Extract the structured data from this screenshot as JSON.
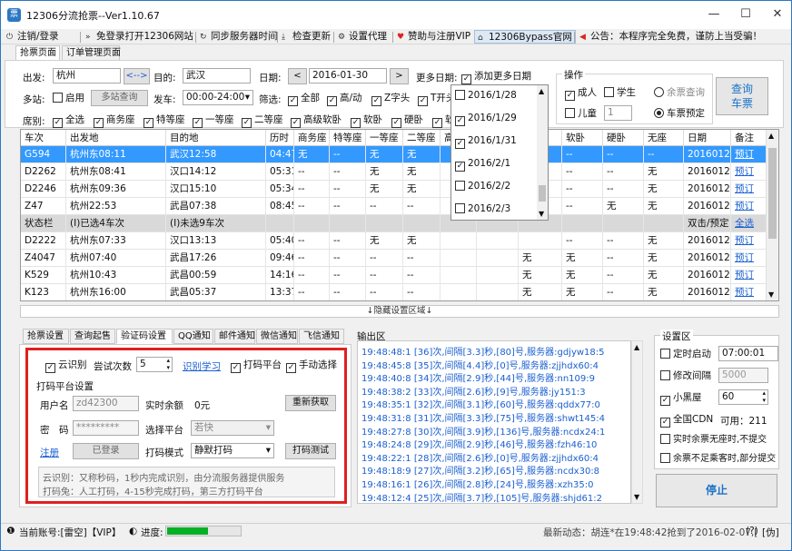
{
  "window": {
    "title": "12306分流抢票--Ver1.10.67",
    "minimize": "—",
    "maximize": "☐",
    "close": "✕"
  },
  "menu": [
    {
      "icon": "logout-icon",
      "glyph": "⏻",
      "label": "注销/登录"
    },
    {
      "icon": "forward-icon",
      "glyph": "»",
      "label": "免登录打开12306网站"
    },
    {
      "icon": "sync-icon",
      "glyph": "↻",
      "label": "同步服务器时间"
    },
    {
      "icon": "download-icon",
      "glyph": "⤓",
      "label": "检查更新"
    },
    {
      "icon": "gear-icon",
      "glyph": "⚙",
      "label": "设置代理"
    },
    {
      "icon": "heart-icon",
      "glyph": "♥",
      "label": "赞助与注册VIP"
    },
    {
      "icon": "home-icon",
      "glyph": "⌂",
      "label": "12306Bypass官网"
    },
    {
      "icon": "speaker-icon",
      "glyph": "◀",
      "label": "公告：本程序完全免费，谨防上当受骗！"
    }
  ],
  "main_tabs": [
    "抢票页面",
    "订单管理页面"
  ],
  "form": {
    "from_label": "出发:",
    "from_value": "杭州",
    "swap_label": "<-->",
    "to_label": "目的:",
    "to_value": "武汉",
    "date_label": "日期:",
    "date_value": "2016-01-30",
    "prev": "<",
    "next": ">",
    "more_dates_label": "更多日期:",
    "add_more_dates": "添加更多日期",
    "multi_label": "多站:",
    "enable_label": "启用",
    "multi_query": "多站查询",
    "depart_label": "发车:",
    "depart_value": "00:00-24:00",
    "filter_label": "筛选:",
    "filters": [
      "全部",
      "高/动",
      "Z字头",
      "T开头"
    ],
    "seat_label": "席别:",
    "seats": [
      "全选",
      "商务座",
      "特等座",
      "一等座",
      "二等座",
      "高级软卧",
      "软卧",
      "硬卧",
      "软"
    ]
  },
  "ops": {
    "title": "操作",
    "adult": "成人",
    "student": "学生",
    "child": "儿童",
    "child_count": "1",
    "query_remaining": "余票查询",
    "predict": "车票预定",
    "query_button": "查询车票"
  },
  "date_dropdown": [
    {
      "date": "2016/1/28",
      "checked": false
    },
    {
      "date": "2016/1/29",
      "checked": true
    },
    {
      "date": "2016/1/31",
      "checked": true
    },
    {
      "date": "2016/2/1",
      "checked": true
    },
    {
      "date": "2016/2/2",
      "checked": false
    },
    {
      "date": "2016/2/3",
      "checked": false
    }
  ],
  "table": {
    "headers": [
      "车次",
      "出发地",
      "目的地",
      "历时",
      "商务座",
      "特等座",
      "一等座",
      "二等座",
      "高",
      "",
      "",
      "软卧",
      "硬卧",
      "无座",
      "日期",
      "备注"
    ],
    "rows": [
      [
        "G594",
        "杭州东08:11",
        "武汉12:58",
        "04:47",
        "无",
        "--",
        "无",
        "无",
        "",
        "",
        "",
        "--",
        "--",
        "--",
        "20160129",
        "预订"
      ],
      [
        "D2262",
        "杭州东08:41",
        "汉口14:12",
        "05:31",
        "--",
        "--",
        "无",
        "无",
        "",
        "",
        "",
        "--",
        "--",
        "无",
        "20160129",
        "预订"
      ],
      [
        "D2246",
        "杭州东09:36",
        "汉口15:10",
        "05:34",
        "--",
        "--",
        "无",
        "无",
        "",
        "",
        "",
        "--",
        "--",
        "无",
        "20160129",
        "预订"
      ],
      [
        "Z47",
        "杭州22:53",
        "武昌07:38",
        "08:45",
        "--",
        "--",
        "--",
        "--",
        "",
        "",
        "",
        "--",
        "无",
        "无",
        "20160129",
        "预订"
      ],
      [
        "状态栏",
        "(I)已选4车次",
        "(I)未选9车次",
        "",
        "",
        "",
        "",
        "",
        "",
        "",
        "",
        "",
        "",
        "",
        "双击/预定",
        "全选"
      ],
      [
        "D2222",
        "杭州东07:33",
        "汉口13:13",
        "05:40",
        "--",
        "--",
        "无",
        "无",
        "",
        "",
        "",
        "--",
        "--",
        "无",
        "20160129",
        "预订"
      ],
      [
        "Z4047",
        "杭州07:40",
        "武昌17:26",
        "09:46",
        "--",
        "--",
        "--",
        "--",
        "",
        "",
        "无",
        "无",
        "--",
        "无",
        "20160129",
        "预订"
      ],
      [
        "K529",
        "杭州10:43",
        "武昌00:59",
        "14:16",
        "--",
        "--",
        "--",
        "--",
        "",
        "",
        "无",
        "无",
        "--",
        "无",
        "20160129",
        "预订"
      ],
      [
        "K123",
        "杭州东16:00",
        "武昌05:37",
        "13:37",
        "--",
        "--",
        "--",
        "--",
        "",
        "",
        "无",
        "无",
        "--",
        "无",
        "20160129",
        "预订"
      ]
    ]
  },
  "hide_settings": "↓隐藏设置区域↓",
  "sub_tabs": [
    "抢票设置",
    "查询起售",
    "验证码设置",
    "QQ通知",
    "邮件通知",
    "微信通知",
    "飞信通知"
  ],
  "captcha": {
    "cloud_label": "云识别",
    "tries_label": "尝试次数",
    "tries_value": "5",
    "learn_link": "识别学习",
    "platform_label": "打码平台",
    "manual_label": "手动选择",
    "group_title": "打码平台设置",
    "user_label": "用户名",
    "user_value": "zd42300",
    "balance_label": "实时余额",
    "balance_value": "0元",
    "refresh": "重新获取",
    "pwd_label": "密　码",
    "pwd_value": "*********",
    "platform_select_label": "选择平台",
    "platform_value": "若快",
    "register": "注册",
    "logged_in": "已登录",
    "mode_label": "打码模式",
    "mode_value": "静默打码",
    "test": "打码测试",
    "note1": "云识别：又称秒码，1秒内完成识别，由分流服务器提供服务",
    "note2": "打码兔：人工打码，4-15秒完成打码，第三方打码平台"
  },
  "output": {
    "title": "输出区",
    "lines": [
      "19:48:48:1 [36]次,间隔[3.3]秒,[80]号,服务器:gdjyw18:5",
      "19:48:45:8 [35]次,间隔[4.4]秒,[0]号,服务器:zjjhdx60:4",
      "19:48:40:8 [34]次,间隔[2.9]秒,[44]号,服务器:nn109:9",
      "19:48:38:2 [33]次,间隔[2.6]秒,[9]号,服务器:jy151:3",
      "19:48:35:1 [32]次,间隔[3.1]秒,[60]号,服务器:qddx77:0",
      "19:48:31:8 [31]次,间隔[3.3]秒,[75]号,服务器:shwt145:4",
      "19:48:27:8 [30]次,间隔[3.9]秒,[136]号,服务器:ncdx24:1",
      "19:48:24:8 [29]次,间隔[2.9]秒,[46]号,服务器:fzh46:10",
      "19:48:22:1 [28]次,间隔[2.6]秒,[0]号,服务器:zjjhdx60:4",
      "19:48:18:9 [27]次,间隔[3.2]秒,[65]号,服务器:ncdx30:8",
      "19:48:16:1 [26]次,间隔[2.8]秒,[24]号,服务器:xzh35:0",
      "19:48:12:4 [25]次,间隔[3.7]秒,[105]号,服务器:shjd61:2"
    ]
  },
  "settings": {
    "title": "设置区",
    "timed_start": "定时启动",
    "timed_value": "07:00:01",
    "modify_interval": "修改间隔",
    "interval_value": "5000",
    "blackroom": "小黑屋",
    "blackroom_value": "60",
    "cdn": "全国CDN",
    "cdn_available": "可用：211",
    "realtime_no_seat": "实时余票无座时,不提交",
    "partial_submit": "余票不足乘客时,部分提交",
    "stop": "停止"
  },
  "status": {
    "account": "当前账号:[雷空]【VIP】",
    "progress_label": "进度:",
    "progress": 0.55,
    "news": "最新动态：胡连*在19:48:42抢到了2016-02-07,[",
    "wifi": "(?)",
    "tail": "[伪]"
  }
}
